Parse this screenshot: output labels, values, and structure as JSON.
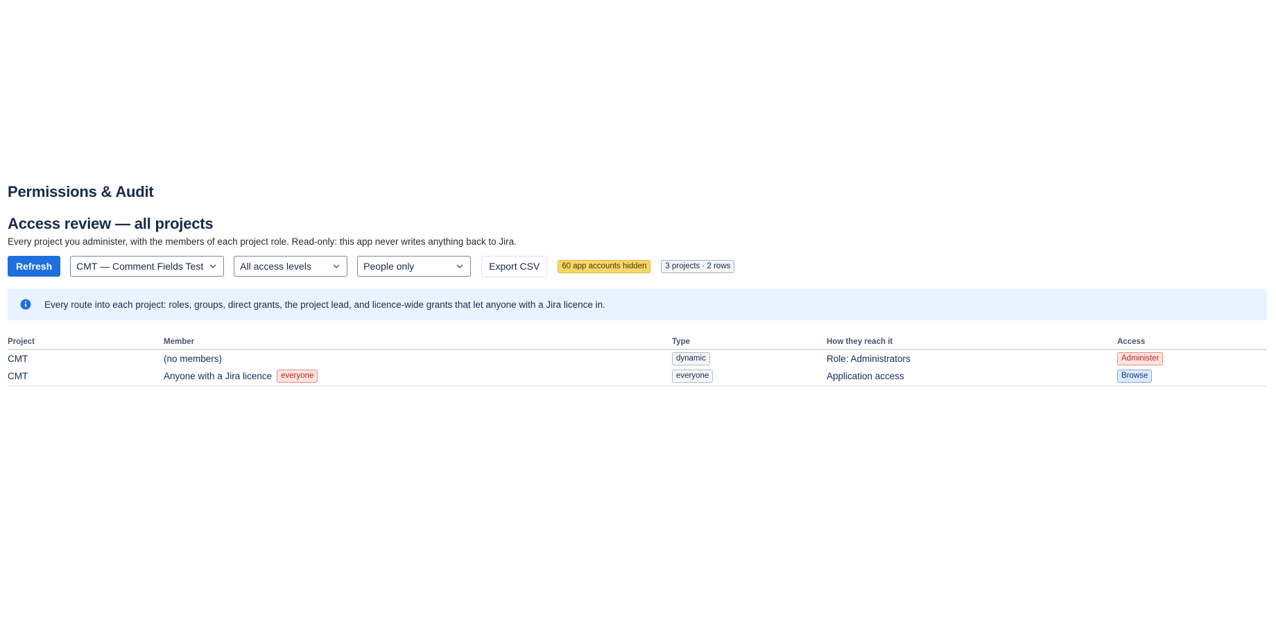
{
  "app": {
    "title": "Permissions & Audit"
  },
  "section": {
    "title": "Access review — all projects",
    "subtitle": "Every project you administer, with the members of each project role. Read-only: this app never writes anything back to Jira."
  },
  "toolbar": {
    "refresh_label": "Refresh",
    "project_select": "CMT — Comment Fields Test",
    "access_select": "All access levels",
    "people_select": "People only",
    "export_label": "Export CSV",
    "hidden_badge": "60 app accounts hidden",
    "count_badge": "3 projects · 2 rows"
  },
  "banner": {
    "text": "Every route into each project: roles, groups, direct grants, the project lead, and licence-wide grants that let anyone with a Jira licence in."
  },
  "table": {
    "headers": [
      "Project",
      "Member",
      "Type",
      "How they reach it",
      "Access"
    ],
    "rows": [
      {
        "project": "CMT",
        "member": "(no members)",
        "member_tag": "",
        "type": "dynamic",
        "route": "Role: Administrators",
        "access": "Administer"
      },
      {
        "project": "CMT",
        "member": "Anyone with a Jira licence",
        "member_tag": "everyone",
        "type": "everyone",
        "route": "Application access",
        "access": "Browse"
      }
    ]
  },
  "colors": {
    "primary": "#1f6fdc",
    "banner_bg": "#e9f2ff",
    "warn_badge": "#f8d66a",
    "danger_badge": "#ffe3e0",
    "info_badge": "#dde9ff"
  },
  "icons": {
    "banner": "info-icon",
    "select": "chevron-down-icon"
  }
}
